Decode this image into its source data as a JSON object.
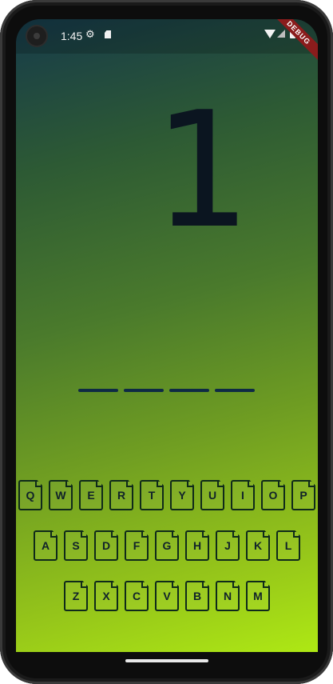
{
  "status_bar": {
    "time": "1:45",
    "icons": [
      "camera-icon",
      "settings-gear-icon",
      "sd-card-icon",
      "wifi-icon",
      "cell-signal-icon",
      "battery-icon"
    ]
  },
  "debug_banner": "DEBUG",
  "game": {
    "hangman_stage": "1",
    "blank_count": 4
  },
  "keyboard": {
    "rows": [
      [
        "Q",
        "W",
        "E",
        "R",
        "T",
        "Y",
        "U",
        "I",
        "O",
        "P"
      ],
      [
        "A",
        "S",
        "D",
        "F",
        "G",
        "H",
        "J",
        "K",
        "L"
      ],
      [
        "Z",
        "X",
        "C",
        "V",
        "B",
        "N",
        "M"
      ]
    ]
  },
  "colors": {
    "gradient_top": "#163a4a",
    "gradient_bottom": "#aee814",
    "ink": "#0b1520",
    "key_border": "#0f2a1a"
  }
}
